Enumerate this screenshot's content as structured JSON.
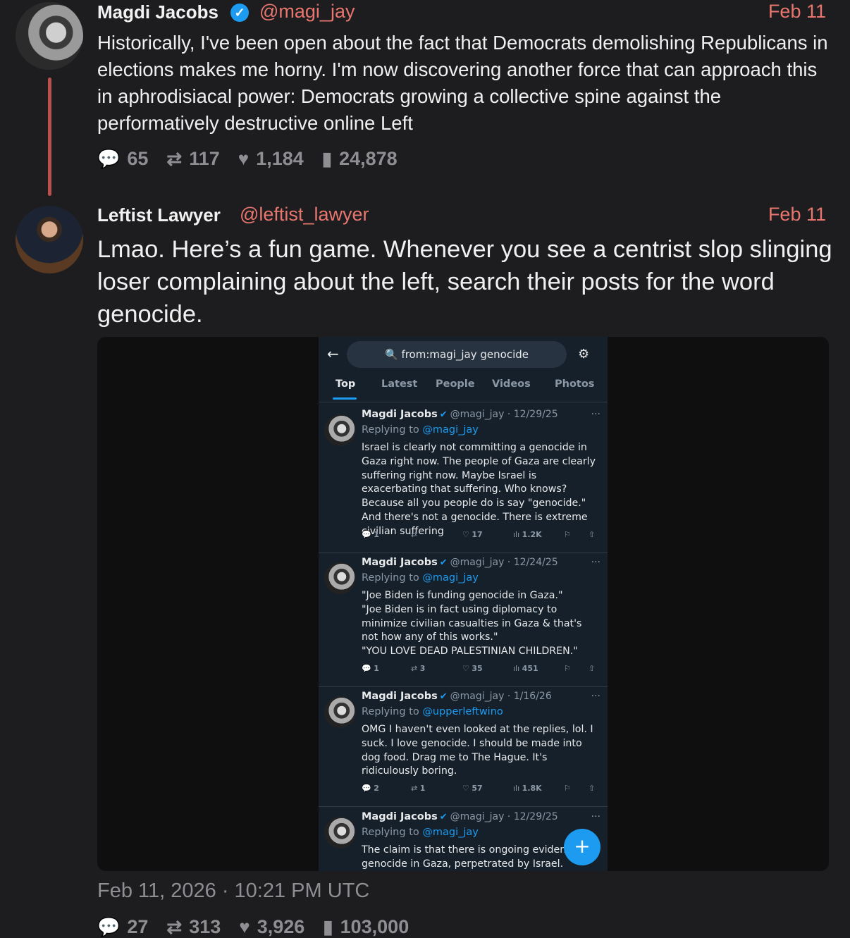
{
  "tweet1": {
    "name": "Magdi Jacobs",
    "handle": "@magi_jay",
    "date": "Feb 11",
    "text": "Historically, I've been open about the fact that Democrats demolishing Republicans in elections makes me horny. I'm now discovering another force that can approach this in aphrodisiacal power: Democrats growing a collective spine against the performatively destructive online Left",
    "replies": "65",
    "retweets": "117",
    "likes": "1,184",
    "views": "24,878"
  },
  "tweet2": {
    "name": "Leftist Lawyer",
    "handle": "@leftist_lawyer",
    "date": "Feb 11",
    "text": "Lmao. Here’s a fun game. Whenever you see a centrist slop slinging loser complaining about the left, search their posts for the word genocide.",
    "timestamp": "Feb 11, 2026 · 10:21 PM UTC",
    "replies": "27",
    "retweets": "313",
    "likes": "3,926",
    "views": "103,000"
  },
  "screenshot": {
    "search_query": "from:magi_jay genocide",
    "tabs": [
      "Top",
      "Latest",
      "People",
      "Videos",
      "Photos"
    ],
    "posts": [
      {
        "name": "Magdi Jacobs",
        "meta": "@magi_jay · 12/29/25",
        "replying_label": "Replying to",
        "replying_to": "@magi_jay",
        "text": "Israel is clearly not committing a genocide in Gaza right now. The people of Gaza are clearly suffering right now. Maybe Israel is exacerbating that suffering. Who knows? Because all you people do is say \"genocide.\" And there's not a genocide. There is extreme civilian suffering",
        "replies": "1",
        "retweets": "",
        "likes": "17",
        "views": "1.2K"
      },
      {
        "name": "Magdi Jacobs",
        "meta": "@magi_jay · 12/24/25",
        "replying_label": "Replying to",
        "replying_to": "@magi_jay",
        "text": "\"Joe Biden is funding genocide in Gaza.\"\n\"Joe Biden is in fact using diplomacy to minimize civilian casualties in Gaza & that's not how any of this works.\"\n\"YOU LOVE DEAD PALESTINIAN CHILDREN.\"",
        "replies": "1",
        "retweets": "3",
        "likes": "35",
        "views": "451"
      },
      {
        "name": "Magdi Jacobs",
        "meta": "@magi_jay · 1/16/26",
        "replying_label": "Replying to",
        "replying_to": "@upperleftwino",
        "text": "OMG I haven't even looked at the replies, lol. I suck. I love genocide. I should be made into dog food. Drag me to The Hague. It's ridiculously boring.",
        "replies": "2",
        "retweets": "1",
        "likes": "57",
        "views": "1.8K"
      },
      {
        "name": "Magdi Jacobs",
        "meta": "@magi_jay · 12/29/25",
        "replying_label": "Replying to",
        "replying_to": "@magi_jay",
        "text": "The claim is that there is ongoing evidence genocide in Gaza, perpetrated by Israel. Please",
        "replies": "",
        "retweets": "",
        "likes": "",
        "views": ""
      }
    ]
  },
  "icons": {
    "reply": "reply-icon",
    "retweet": "retweet-icon",
    "like": "heart-icon",
    "views": "views-icon"
  },
  "colors": {
    "accent": "#e8766e",
    "thread_line": "#b9504d",
    "twitter_blue": "#1d9bf0"
  }
}
